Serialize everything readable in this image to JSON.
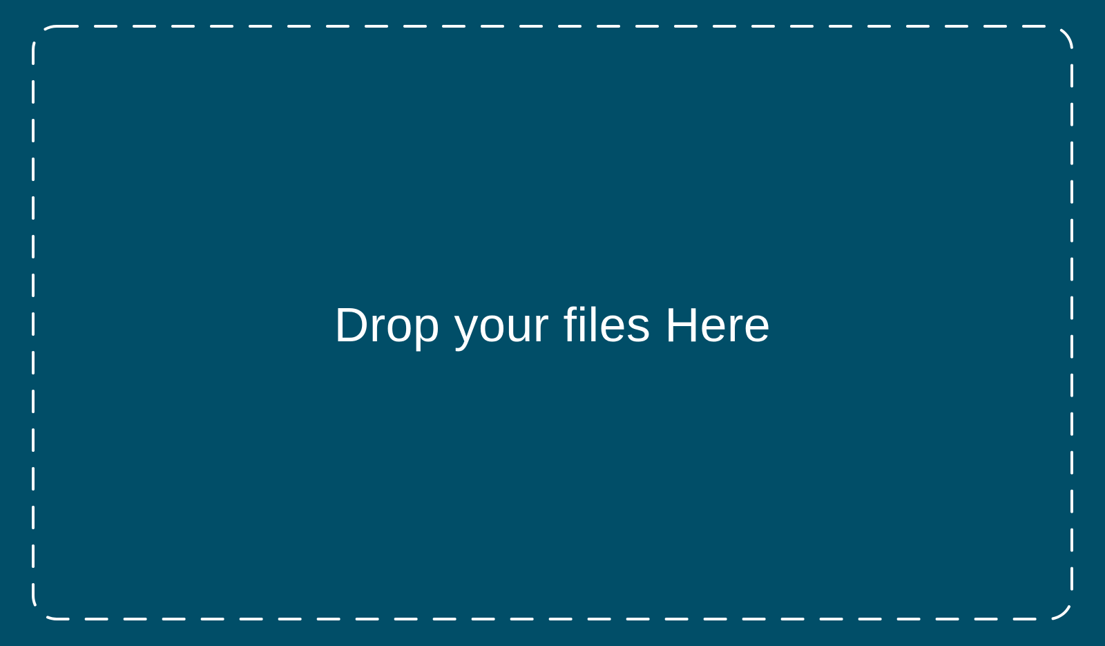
{
  "drop_zone": {
    "label": "Drop your files Here"
  },
  "colors": {
    "background": "#014e68",
    "border": "#ffffff",
    "text": "#ffffff"
  }
}
